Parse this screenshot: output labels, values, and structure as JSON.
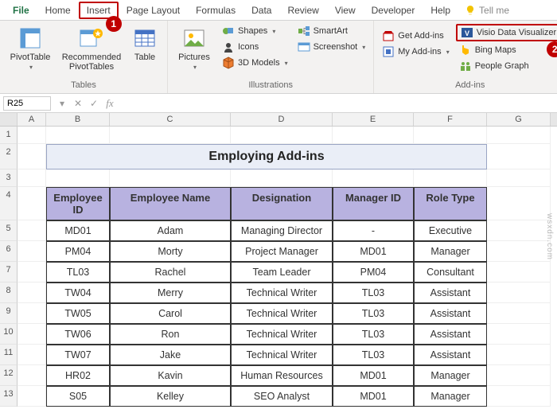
{
  "tabs": {
    "file": "File",
    "home": "Home",
    "insert": "Insert",
    "pagelayout": "Page Layout",
    "formulas": "Formulas",
    "data": "Data",
    "review": "Review",
    "view": "View",
    "developer": "Developer",
    "help": "Help",
    "tellme": "Tell me"
  },
  "callouts": {
    "insert": "1",
    "visio": "2"
  },
  "ribbon": {
    "tables": {
      "pivottable": "PivotTable",
      "recommended": "Recommended\nPivotTables",
      "table": "Table",
      "group": "Tables"
    },
    "illustrations": {
      "pictures": "Pictures",
      "shapes": "Shapes",
      "icons": "Icons",
      "models": "3D Models",
      "smartart": "SmartArt",
      "screenshot": "Screenshot",
      "group": "Illustrations"
    },
    "addins": {
      "get": "Get Add-ins",
      "my": "My Add-ins",
      "visio": "Visio Data Visualizer",
      "bing": "Bing Maps",
      "people": "People Graph",
      "group": "Add-ins"
    }
  },
  "namebox": "R25",
  "fx_symbols": {
    "down": "▾",
    "cancel": "✕",
    "check": "✓",
    "fx": "fx"
  },
  "columns": [
    "",
    "A",
    "B",
    "C",
    "D",
    "E",
    "F",
    "G"
  ],
  "rownums": [
    "1",
    "2",
    "3",
    "4",
    "5",
    "6",
    "7",
    "8",
    "9",
    "10",
    "11",
    "12",
    "13"
  ],
  "title": "Employing Add-ins",
  "headers": [
    "Employee ID",
    "Employee Name",
    "Designation",
    "Manager ID",
    "Role Type"
  ],
  "data": [
    [
      "MD01",
      "Adam",
      "Managing Director",
      "-",
      "Executive"
    ],
    [
      "PM04",
      "Morty",
      "Project Manager",
      "MD01",
      "Manager"
    ],
    [
      "TL03",
      "Rachel",
      "Team Leader",
      "PM04",
      "Consultant"
    ],
    [
      "TW04",
      "Merry",
      "Technical Writer",
      "TL03",
      "Assistant"
    ],
    [
      "TW05",
      "Carol",
      "Technical Writer",
      "TL03",
      "Assistant"
    ],
    [
      "TW06",
      "Ron",
      "Technical Writer",
      "TL03",
      "Assistant"
    ],
    [
      "TW07",
      "Jake",
      "Technical Writer",
      "TL03",
      "Assistant"
    ],
    [
      "HR02",
      "Kavin",
      "Human Resources",
      "MD01",
      "Manager"
    ],
    [
      "S05",
      "Kelley",
      "SEO Analyst",
      "MD01",
      "Manager"
    ]
  ],
  "watermark": "wsxdn.com"
}
